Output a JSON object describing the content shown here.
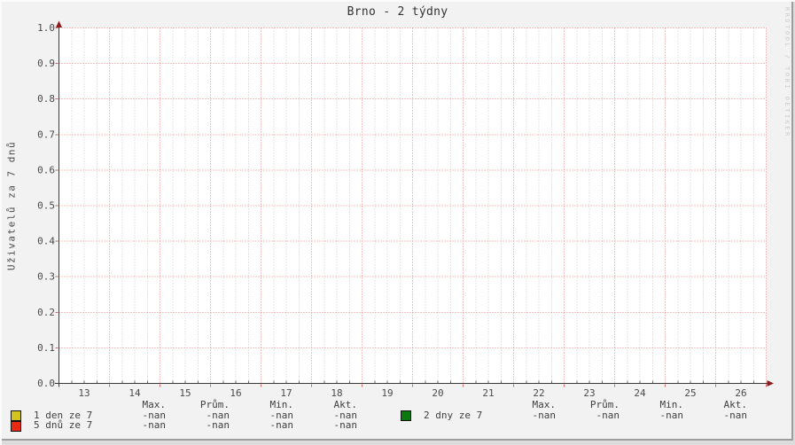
{
  "title": "Brno - 2 týdny",
  "ylabel": "Uživatelů za 7 dnů",
  "watermark": "RRDTOOL / TOBI OETIKER",
  "colors": {
    "background": "#f2f2f2",
    "canvas": "#ffffff",
    "grid_minor": "#c9c9c9",
    "grid_major": "#e58a8a",
    "tick": "#cc6666",
    "axis": "#3a3a3a",
    "arrow": "#8c1c1c",
    "text": "#4a4a4a"
  },
  "chart_data": {
    "type": "line",
    "title": "Brno - 2 týdny",
    "ylabel": "Uživatelů za 7 dnů",
    "x_ticks": [
      13,
      14,
      15,
      16,
      17,
      18,
      19,
      20,
      21,
      22,
      23,
      24,
      25,
      26
    ],
    "x_tick_labels": [
      "13",
      "14",
      "15",
      "16",
      "17",
      "18",
      "19",
      "20",
      "21",
      "22",
      "23",
      "24",
      "25",
      "26"
    ],
    "y_tick_labels": [
      "0.0",
      "0.1",
      "0.2",
      "0.3",
      "0.4",
      "0.5",
      "0.6",
      "0.7",
      "0.8",
      "0.9",
      "1.0"
    ],
    "ylim": [
      0.0,
      1.0
    ],
    "y_tick_step": 0.1,
    "grid": "dotted, red major lines per day and per 0.1, gray minor lines per quarter day",
    "legend_position": "bottom",
    "series": [
      {
        "name": "1 den ze 7",
        "color": "#d1c41e",
        "values": [],
        "max": "-nan",
        "avg": "-nan",
        "min": "-nan",
        "akt": "-nan"
      },
      {
        "name": "5 dnů ze 7",
        "color": "#e92a12",
        "values": [],
        "max": "-nan",
        "avg": "-nan",
        "min": "-nan",
        "akt": "-nan"
      },
      {
        "name": "2 dny ze 7",
        "color": "#0b790f",
        "values": [],
        "max": "-nan",
        "avg": "-nan",
        "min": "-nan",
        "akt": "-nan"
      }
    ]
  },
  "legend": {
    "columns": [
      "Max.",
      "Prům.",
      "Min.",
      "Akt."
    ],
    "rows": [
      {
        "label": "1 den ze 7",
        "color": "#d1c41e",
        "values": [
          "-nan",
          "-nan",
          "-nan",
          "-nan"
        ]
      },
      {
        "label": "5 dnů ze 7",
        "color": "#e92a12",
        "values": [
          "-nan",
          "-nan",
          "-nan",
          "-nan"
        ]
      },
      {
        "label": "2 dny ze 7",
        "color": "#0b790f",
        "values": [
          "-nan",
          "-nan",
          "-nan",
          "-nan"
        ]
      }
    ]
  }
}
